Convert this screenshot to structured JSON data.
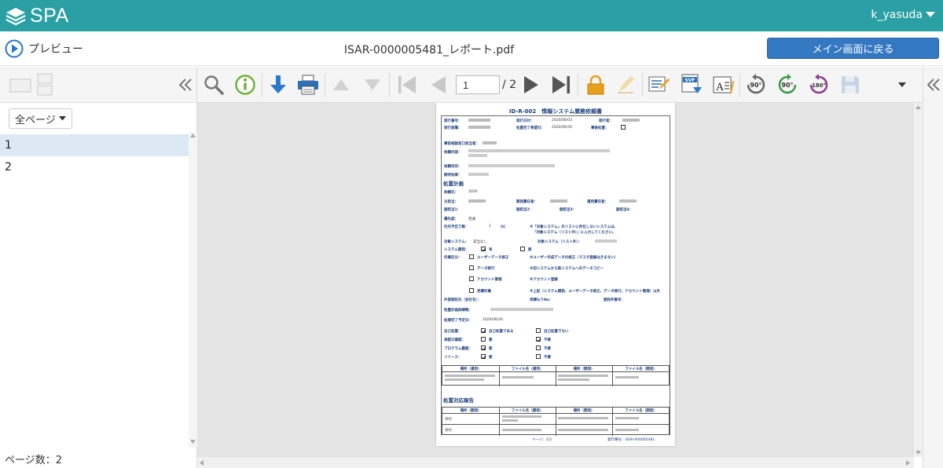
{
  "header": {
    "app_name": "SPA",
    "user": "k_yasuda"
  },
  "subheader": {
    "preview_label": "プレビュー",
    "document_title": "ISAR-0000005481_レポート.pdf",
    "back_button": "メイン画面に戻る"
  },
  "toolbar": {
    "current_page": "1",
    "total_pages": "/ 2"
  },
  "sidebar": {
    "page_filter": "全ページ",
    "pages": [
      "1",
      "2"
    ],
    "page_count": "ページ数：2"
  },
  "document": {
    "title": "ID-R-002　情報システム業務依頼書",
    "labels": {
      "doc_no": "発行番号：",
      "issue_date": "発行日付：",
      "issuer": "発行者：",
      "dept": "発行部署：",
      "due_date": "処置完了希望日：",
      "review": "事後処置：",
      "contact": "事前相談窓口担当者：",
      "request": "依頼内容：",
      "purpose": "依頼目的：",
      "effect": "期待効果：",
      "plan": "処置計画",
      "receiver": "依頼先：",
      "main_owner": "主担当：",
      "dev_lead": "開発責任者：",
      "ops_lead": "運用責任者：",
      "sub1": "副担当1：",
      "sub2": "副担当2：",
      "sub3": "副担当3：",
      "sub4": "副担当4：",
      "priority": "優先度：",
      "effort": "社内予定工数：",
      "effort_unit": "（h）",
      "effort_note1": "※「対象システム」のリストに存在しないシステムは、",
      "effort_note2": "「対象システム（リスト外）」に入力してください。",
      "target_sys": "対象システム：",
      "target_sys_out": "対象システム（リスト外）：",
      "dev_flag": "システム開発：",
      "dev_yes": "有",
      "dev_no": "無",
      "work_cat": "作業区分：",
      "opt1": "ユーザーデータ修正",
      "opt1n": "※ユーザー作成データの修正（マスタ登録はきまない）",
      "opt2": "データ移行",
      "opt2n": "※旧システムから新システムへのデータコピー",
      "opt3": "アカウント管理",
      "opt3n": "※アカウント登録",
      "opt4": "見積作業",
      "opt4n": "※上記（システム開発、ユーザーデータ修正、データ移行、アカウント管理）以外",
      "ext_vendor": "外部委託先（会社名）：",
      "estimate_no": "見積もりNo：",
      "order_no": "委託件番号：",
      "plan_detail": "処置計画詳細略：",
      "plan_date": "処理完了予定日：",
      "self_approve": "自己処置：",
      "self_yes": "自己処置である",
      "self_no": "自己処置でない",
      "approval": "承認元確認：",
      "need": "要",
      "no_need": "不要",
      "program": "プログラム履歴：",
      "release": "リリース：",
      "col_place": "場所（運用）",
      "col_file": "ファイル名（運用）",
      "col_place_dev": "場所（開発）",
      "col_file_dev": "ファイル名（開発）",
      "report": "処置対応報告",
      "col_place2": "場所（開発）",
      "col_file2": "ファイル名（開発）",
      "col_place3": "場所（開発）",
      "col_file3": "ファイル名（開発）",
      "attach1": "添付",
      "attach2": "添付",
      "footer_page": "ページ：1/2",
      "footer_no": "発行番号：ISAR-000005481"
    },
    "values": {
      "issue_date": "2020/06/03",
      "due_date": "2020/06/30",
      "receiver": "2020",
      "priority": "普通",
      "effort": "1",
      "target_sys": "該当なし",
      "plan_date": "2020/06/30"
    }
  },
  "colors": {
    "brand": "#2aa0a4",
    "button": "#3578c2",
    "selected_row": "#dce9f5"
  },
  "icons": [
    "search-icon",
    "info-icon",
    "download-icon",
    "print-icon",
    "prev-icon",
    "next-icon",
    "first-page-icon",
    "prev-page-icon",
    "next-page-icon",
    "last-page-icon",
    "lock-icon",
    "edit-icon",
    "annotate-icon",
    "svf-icon",
    "text-icon",
    "rotate-90-ccw-icon",
    "rotate-90-cw-icon",
    "rotate-180-icon",
    "save-icon"
  ]
}
